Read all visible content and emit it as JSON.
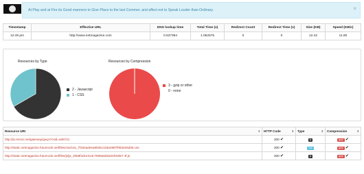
{
  "alert": {
    "text": "At Play and at Fire its Good manners to Give Place to the last Commer, and affect not to Speak Louder than Ordinary.",
    "close_icon": "×"
  },
  "summary": {
    "headers": [
      "Timestamp",
      "Effective URL",
      "DNS lookup time",
      "Total Time (s)",
      "Redirect Count",
      "Redirect Time (s)",
      "Size (KB)",
      "Speed (KB/s)"
    ],
    "row": [
      "12:49 pm",
      "http://www.netmagazine.com",
      "0.537384",
      "1.052575",
      "0",
      "0",
      "12.42",
      "11.80"
    ]
  },
  "charts": {
    "type_title": "Resources by Type",
    "type_legend": [
      "2 - Javascript",
      "1 - CSS"
    ],
    "compression_title": "Resources by Compression",
    "compression_legend": [
      "3 - gzip or other",
      "0 - none"
    ]
  },
  "chart_data": [
    {
      "type": "pie",
      "title": "Resources by Type",
      "labels": [
        "Javascript",
        "CSS"
      ],
      "values": [
        2,
        1
      ],
      "colors": [
        "#333333",
        "#6ec3cc"
      ],
      "legend": "right"
    },
    {
      "type": "pie",
      "title": "Resources by Compression",
      "labels": [
        "gzip or other",
        "none"
      ],
      "values": [
        3,
        0
      ],
      "colors": [
        "#ea4a4a",
        "#ffffff"
      ],
      "legend": "right"
    }
  ],
  "resources": {
    "headers": [
      "Resource URI",
      "HTTP Code",
      "Type",
      "Compression"
    ],
    "rows": [
      {
        "uri": "http://js.revsci.net/gateway/gw.js?csid=a08721",
        "code": "200",
        "type": "js",
        "type_color": "#333333",
        "compression": "gzip"
      },
      {
        "uri": "http://static.netmagazine.futurecdn.net/files/css/css_7f184adeea8025c118a4987f0832e5d35.css",
        "code": "200",
        "type": "css",
        "type_color": "#5bc0de",
        "compression": "gzip"
      },
      {
        "uri": "http://static.netmagazine.futurecdn.net/files/js/js_2059f4dce313c7908a9d2a04fc6057 4f.js",
        "code": "200",
        "type": "js",
        "type_color": "#333333",
        "compression": "gzip"
      }
    ],
    "sort_icon": "⇕",
    "check_icon": "✔",
    "gzip_color": "#d9534f"
  }
}
